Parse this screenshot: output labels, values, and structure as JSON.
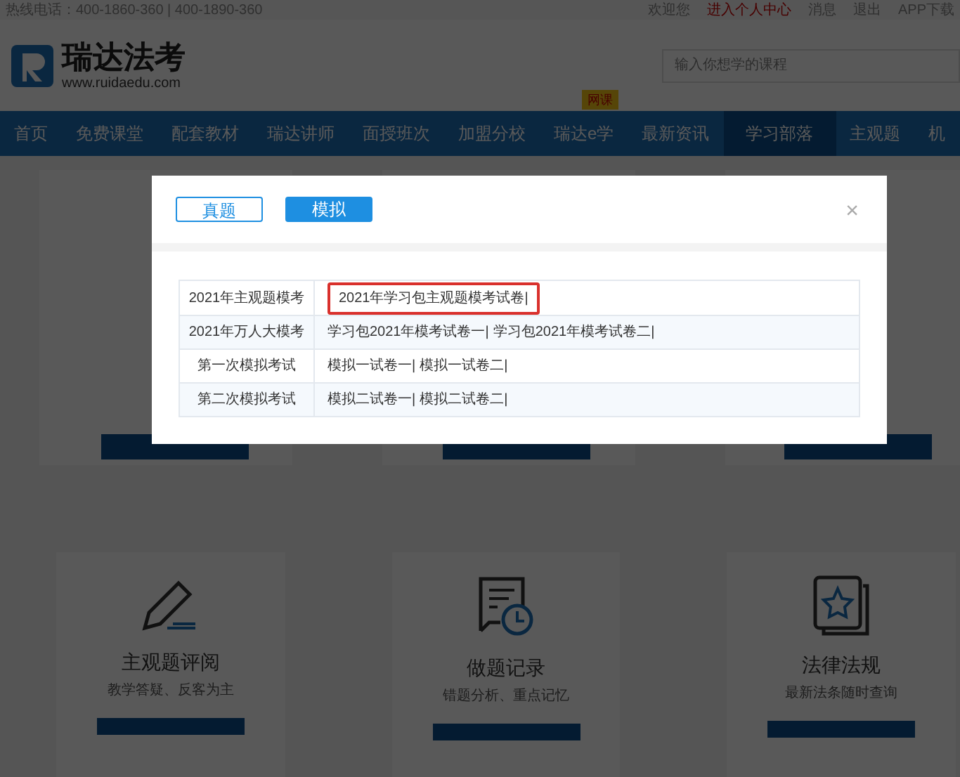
{
  "top_bar": {
    "hotline": "热线电话：400-1860-360  |  400-1890-360",
    "links": [
      "欢迎您",
      "进入个人中心",
      "消息",
      "退出",
      "APP下载"
    ]
  },
  "header": {
    "logo_name": "瑞达法考",
    "logo_url": "www.ruidaedu.com",
    "search": {
      "placeholder": "输入你想学的课程"
    }
  },
  "nav": [
    {
      "label": "首页",
      "selected": false
    },
    {
      "label": "免费课堂",
      "selected": false
    },
    {
      "label": "配套教材",
      "selected": false
    },
    {
      "label": "瑞达讲师",
      "selected": false
    },
    {
      "label": "面授班次",
      "selected": false
    },
    {
      "label": "加盟分校",
      "selected": false
    },
    {
      "label": "瑞达e学",
      "selected": false,
      "badge": "网课"
    },
    {
      "label": "最新资讯",
      "selected": false
    },
    {
      "label": "学习部落",
      "selected": true
    },
    {
      "label": "主观题",
      "selected": false
    },
    {
      "label": "机",
      "selected": false
    }
  ],
  "cards": [
    {
      "kind": "pencil",
      "title": "主观题评阅",
      "subtitle": "教学答疑、反客为主"
    },
    {
      "kind": "record",
      "title": "做题记录",
      "subtitle": "错题分析、重点记忆"
    },
    {
      "kind": "law",
      "title": "法律法规",
      "subtitle": "最新法条随时查询"
    }
  ],
  "modal": {
    "tabs": [
      {
        "label": "真题",
        "selected": false
      },
      {
        "label": "模拟",
        "selected": true
      }
    ],
    "close": "×",
    "rows": [
      {
        "label": "2021年主观题模考",
        "links": [
          {
            "text": "2021年学习包主观题模考试卷|",
            "highlighted": true
          }
        ]
      },
      {
        "label": "2021年万人大模考",
        "links": [
          {
            "text": "学习包2021年模考试卷一|",
            "highlighted": false
          },
          {
            "text": "学习包2021年模考试卷二|",
            "highlighted": false
          }
        ]
      },
      {
        "label": "第一次模拟考试",
        "links": [
          {
            "text": "模拟一试卷一|",
            "highlighted": false
          },
          {
            "text": "模拟一试卷二|",
            "highlighted": false
          }
        ]
      },
      {
        "label": "第二次模拟考试",
        "links": [
          {
            "text": "模拟二试卷一|",
            "highlighted": false
          },
          {
            "text": "模拟二试卷二|",
            "highlighted": false
          }
        ]
      }
    ]
  }
}
